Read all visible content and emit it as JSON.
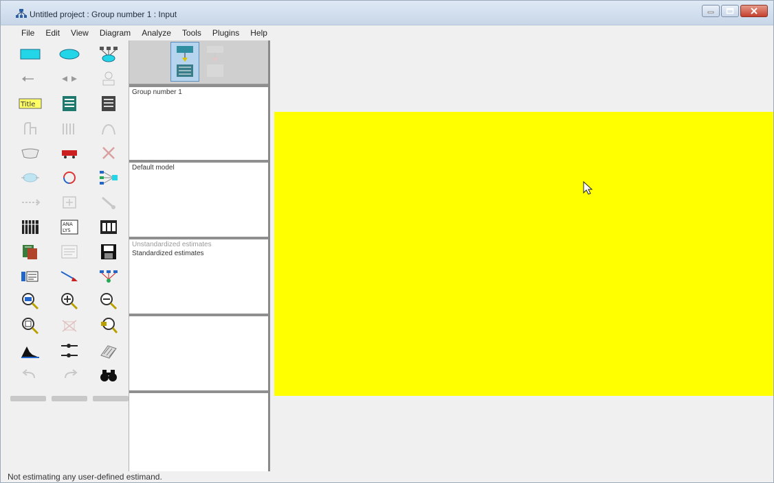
{
  "window": {
    "title": "Untitled project : Group number 1 : Input",
    "icon": "app-icon",
    "controls": [
      "minimize-icon",
      "maximize-icon",
      "close-icon"
    ]
  },
  "menu": {
    "items": [
      "File",
      "Edit",
      "View",
      "Diagram",
      "Analyze",
      "Tools",
      "Plugins",
      "Help"
    ]
  },
  "toolbox": {
    "tools": [
      "draw-observed-variable-icon",
      "draw-unobserved-variable-icon",
      "draw-latent-variable-icon",
      "draw-path-icon",
      "draw-covariance-icon",
      "add-unique-variable-icon",
      "figure-caption-icon",
      "list-variables-in-model-icon",
      "list-variables-in-dataset-icon",
      "select-one-object-icon",
      "select-all-objects-icon",
      "deselect-all-objects-icon",
      "duplicate-objects-icon",
      "move-objects-icon",
      "erase-objects-icon",
      "change-shape-icon",
      "rotate-indicators-icon",
      "reflect-indicators-icon",
      "move-parameter-values-icon",
      "scroll-icon",
      "touch-up-icon",
      "select-data-files-icon",
      "analysis-properties-icon",
      "calculate-estimates-icon",
      "copy-to-clipboard-icon",
      "view-text-icon",
      "save-diagram-icon",
      "object-properties-icon",
      "drag-properties-icon",
      "preserve-symmetries-icon",
      "zoom-in-icon",
      "zoom-in-plus-icon",
      "zoom-out-icon",
      "zoom-page-icon",
      "fit-to-page-icon",
      "loupe-icon",
      "bayesian-estimation-icon",
      "multiple-group-analysis-icon",
      "print-icon",
      "undo-icon",
      "redo-icon",
      "specification-search-icon"
    ]
  },
  "modes": {
    "items": [
      "input-path-diagram-icon",
      "output-path-diagram-icon"
    ],
    "active": 0
  },
  "panes": {
    "groups_label": "Group number 1",
    "models_label": "Default model",
    "format_label": "Unstandardized estimates",
    "format_value": "Standardized estimates"
  },
  "colors": {
    "diagram_background": "#ffff00"
  },
  "status": {
    "text": "Not estimating any user-defined estimand."
  }
}
